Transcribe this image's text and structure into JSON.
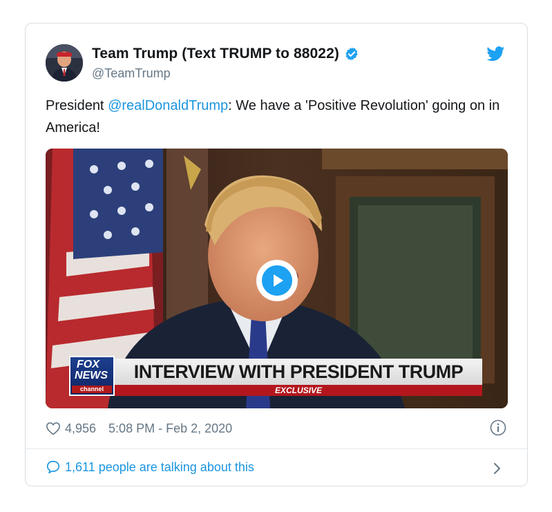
{
  "tweet": {
    "display_name": "Team Trump (Text TRUMP to 88022)",
    "handle": "@TeamTrump",
    "verified_icon": "verified-badge-icon",
    "platform_icon": "twitter-bird-icon",
    "text_prefix": "President ",
    "mention": "@realDonaldTrump",
    "text_suffix": ": We have a 'Positive Revolution' going on in America!",
    "media": {
      "logo_line1": "FOX",
      "logo_line2": "NEWS",
      "logo_line3": "channel",
      "banner": "INTERVIEW WITH PRESIDENT TRUMP",
      "subbanner": "EXCLUSIVE",
      "play_icon": "play-icon"
    },
    "likes": "4,956",
    "timestamp": "5:08 PM - Feb 2, 2020",
    "talking": "1,611 people are talking about this"
  },
  "colors": {
    "link": "#1b95e0",
    "muted": "#657786",
    "accent": "#1da1f2"
  }
}
